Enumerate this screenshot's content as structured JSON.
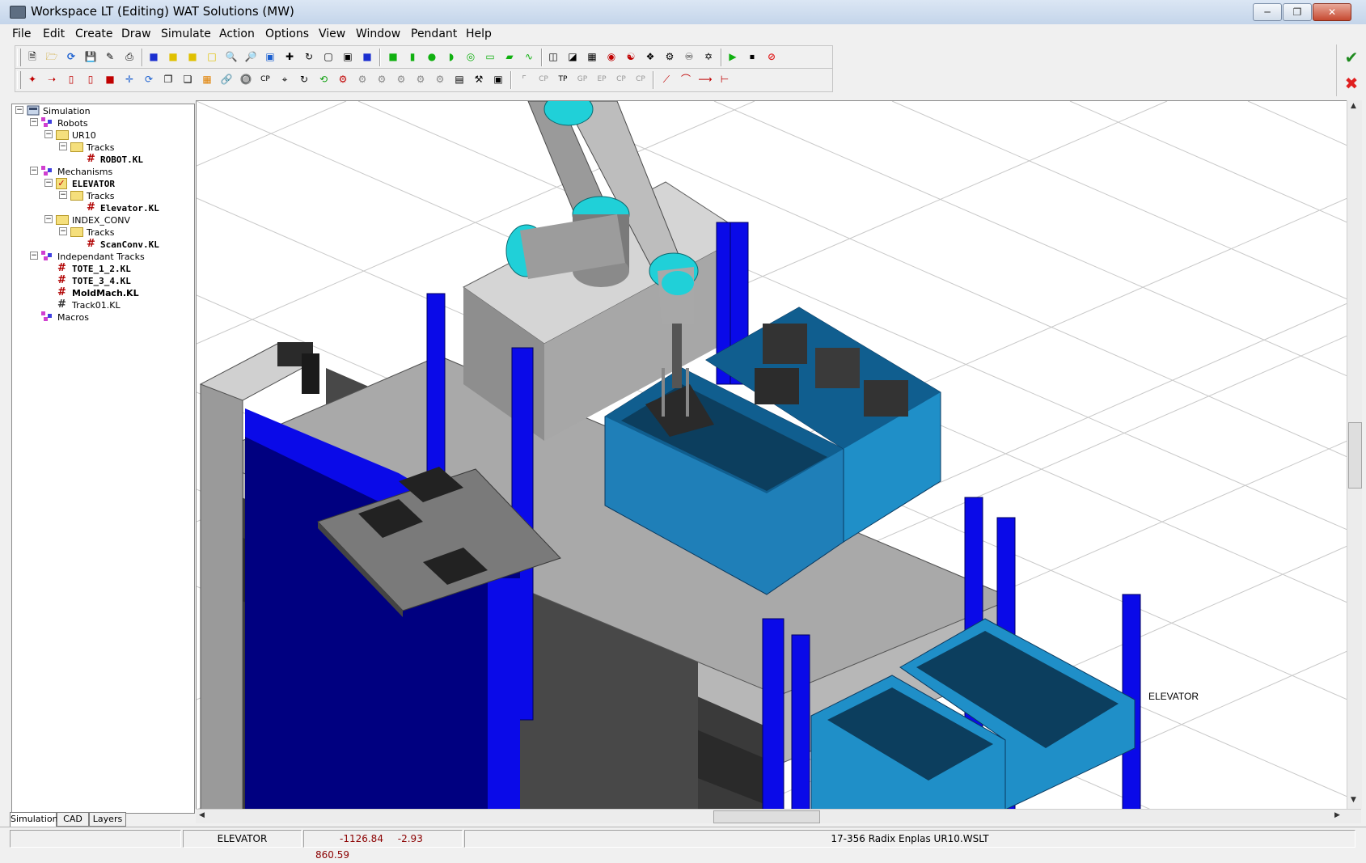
{
  "window": {
    "title": "Workspace LT  (Editing) WAT Solutions (MW)",
    "controls": [
      "minimize",
      "restore",
      "close"
    ]
  },
  "menu": [
    "File",
    "Edit",
    "Create",
    "Draw",
    "Simulate",
    "Action",
    "Options",
    "View",
    "Window",
    "Pendant",
    "Help"
  ],
  "toolbar": {
    "ok_icon": "checkmark-icon",
    "cancel_icon": "red-x-icon"
  },
  "tree": {
    "nodes": [
      {
        "label": "Simulation",
        "depth": 0,
        "icon": "simulation-icon"
      },
      {
        "label": "Robots",
        "depth": 1,
        "icon": "robot-group-icon"
      },
      {
        "label": "UR10",
        "depth": 2,
        "icon": "folder-icon"
      },
      {
        "label": "Tracks",
        "depth": 3,
        "icon": "folder-icon"
      },
      {
        "label": "ROBOT.KL",
        "depth": 4,
        "icon": "kl-file-icon"
      },
      {
        "label": "Mechanisms",
        "depth": 1,
        "icon": "robot-group-icon"
      },
      {
        "label": "ELEVATOR",
        "depth": 2,
        "icon": "checked-folder-icon"
      },
      {
        "label": "Tracks",
        "depth": 3,
        "icon": "folder-icon"
      },
      {
        "label": "Elevator.KL",
        "depth": 4,
        "icon": "kl-file-icon"
      },
      {
        "label": "INDEX_CONV",
        "depth": 2,
        "icon": "folder-icon"
      },
      {
        "label": "Tracks",
        "depth": 3,
        "icon": "folder-icon"
      },
      {
        "label": "ScanConv.KL",
        "depth": 4,
        "icon": "kl-file-icon"
      },
      {
        "label": "Independant Tracks",
        "depth": 1,
        "icon": "robot-group-icon"
      },
      {
        "label": "TOTE_1_2.KL",
        "depth": 2,
        "icon": "kl-file-icon"
      },
      {
        "label": "TOTE_3_4.KL",
        "depth": 2,
        "icon": "kl-file-icon"
      },
      {
        "label": "MoldMach.KL",
        "depth": 2,
        "icon": "kl-file-icon"
      },
      {
        "label": "Track01.KL",
        "depth": 2,
        "icon": "kl-file-icon"
      },
      {
        "label": "Macros",
        "depth": 1,
        "icon": "robot-group-icon"
      }
    ]
  },
  "tabs": [
    "Simulation",
    "CAD",
    "Layers"
  ],
  "viewport": {
    "label": "ELEVATOR"
  },
  "status": {
    "selected": "ELEVATOR",
    "x": "-1126.84",
    "y": "-2.93",
    "z": "860.59",
    "file": "17-356 Radix Enplas UR10.WSLT"
  },
  "colors": {
    "conveyor_blue": "#0a0ae8",
    "tote_blue": "#1f8fc8",
    "robot_cyan": "#20d0d8",
    "table_gray": "#b7b7b7"
  }
}
